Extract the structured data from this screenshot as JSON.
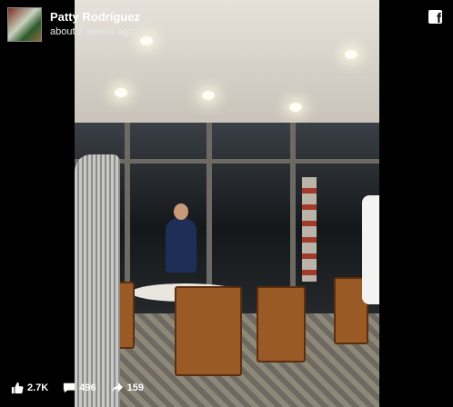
{
  "post": {
    "author": "Patty Rodríguez",
    "time": "about 2 weeks ago",
    "avatar_icon": "profile-photo",
    "platform_icon": "facebook-icon",
    "platform_glyph": "f"
  },
  "stats": {
    "likes": "2.7K",
    "comments": "496",
    "shares": "159",
    "like_icon": "thumbs-up-icon",
    "comment_icon": "comment-icon",
    "share_icon": "share-arrow-icon"
  },
  "video": {
    "scene_icon": "restaurant-video-frame"
  },
  "colors": {
    "background": "#000000",
    "text": "#ffffff",
    "chair_wood": "#9a5a26"
  }
}
